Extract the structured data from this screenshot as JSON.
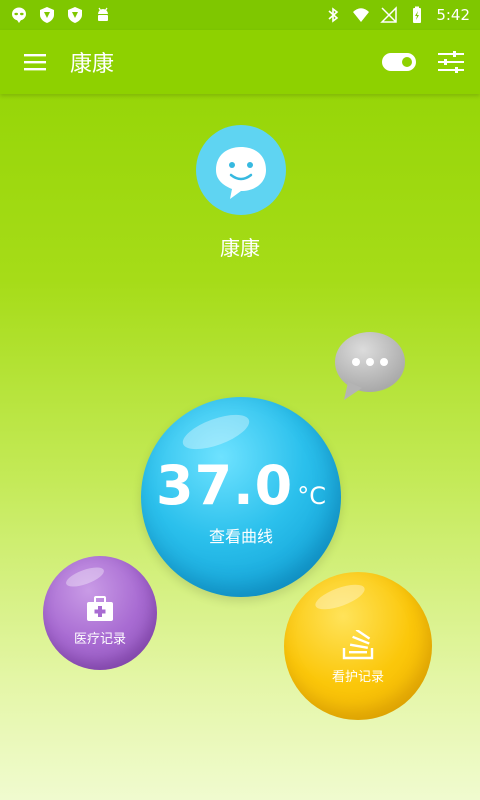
{
  "status_bar": {
    "time": "5:42",
    "left_icons": [
      "alien-icon",
      "shield-icon",
      "shield-icon",
      "android-icon"
    ],
    "right_icons": [
      "bluetooth-icon",
      "wifi-icon",
      "signal-icon",
      "battery-icon"
    ]
  },
  "app_bar": {
    "title": "康康",
    "menu_icon": "menu-icon",
    "toggle_state": "on",
    "settings_icon": "sliders-icon"
  },
  "profile": {
    "name": "康康"
  },
  "temperature": {
    "value": "37.0",
    "unit": "°C",
    "label": "查看曲线"
  },
  "medical_record": {
    "label": "医疗记录"
  },
  "care_record": {
    "label": "看护记录"
  },
  "colors": {
    "primary": "#8ed100",
    "temp_bubble": "#2bc0ec",
    "medical_bubble": "#a86bd2",
    "care_bubble": "#fbc70a",
    "avatar_bg": "#5fd4f2"
  }
}
